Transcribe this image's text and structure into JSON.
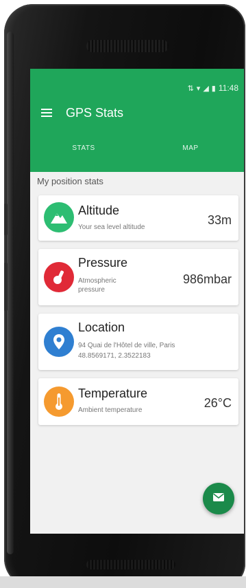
{
  "status_bar": {
    "time": "11:48",
    "signal_icon": "signal-icon",
    "wifi_icon": "wifi-icon",
    "battery_icon": "battery-icon"
  },
  "app_bar": {
    "title": "GPS Stats",
    "menu_icon": "hamburger-menu-icon",
    "color": "#1fa65a"
  },
  "tabs": [
    {
      "label": "STATS",
      "selected": true
    },
    {
      "label": "MAP",
      "selected": false
    }
  ],
  "section_title": "My position stats",
  "stats": [
    {
      "key": "altitude",
      "title": "Altitude",
      "subtitle": "Your sea level altitude",
      "value": "33m",
      "icon": "mountain-icon",
      "color": "#2dbd72"
    },
    {
      "key": "pressure",
      "title": "Pressure",
      "subtitle": "Atmospheric pressure",
      "value": "986mbar",
      "icon": "gauge-icon",
      "color": "#e02a37"
    },
    {
      "key": "location",
      "title": "Location",
      "subtitle": "94 Quai de l'Hôtel de ville, Paris",
      "subtitle2": "48.8569171, 2.3522183",
      "value": "",
      "icon": "location-pin-icon",
      "color": "#2f7fd1"
    },
    {
      "key": "temperature",
      "title": "Temperature",
      "subtitle": "Ambient temperature",
      "value": "26°C",
      "icon": "thermometer-icon",
      "color": "#f59a2f"
    }
  ],
  "fab": {
    "icon": "mail-icon",
    "color": "#1b8a4a"
  }
}
